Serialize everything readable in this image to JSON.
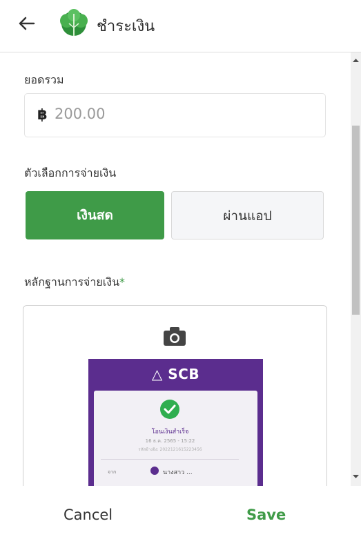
{
  "header": {
    "title": "ชำระเงิน",
    "back_icon": "arrow-left-icon",
    "logo_icon": "green-leaf-logo"
  },
  "total": {
    "label": "ยอดรวม",
    "currency_symbol": "฿",
    "amount": "200.00"
  },
  "payment_options": {
    "label": "ตัวเลือกการจ่ายเงิน",
    "cash_label": "เงินสด",
    "app_label": "ผ่านแอป",
    "selected": "cash",
    "accent_color": "#3f9b48"
  },
  "proof": {
    "label": "หลักฐานการจ่ายเงิน",
    "required_mark": "*",
    "camera_icon": "camera-icon",
    "slip": {
      "brand": "SCB",
      "status": "โอนเงินสำเร็จ",
      "date": "16 ธ.ค. 2565 - 15:22",
      "ref": "รหัสอ้างอิง: 2022121615223456",
      "from_label": "จาก",
      "from_name": "นางสาว ..."
    }
  },
  "footer": {
    "cancel_label": "Cancel",
    "save_label": "Save"
  }
}
